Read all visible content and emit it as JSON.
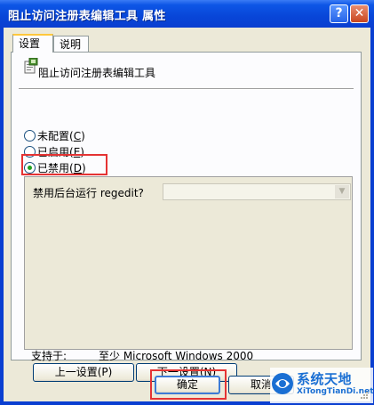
{
  "window": {
    "title": "阻止访问注册表编辑工具 属性",
    "help_glyph": "?",
    "close_glyph": "✕"
  },
  "tabs": [
    {
      "label": "设置",
      "active": true
    },
    {
      "label": "说明",
      "active": false
    }
  ],
  "policy": {
    "title": "阻止访问注册表编辑工具",
    "icon": "policy-setting-icon"
  },
  "radios": [
    {
      "label": "未配置",
      "key": "C",
      "checked": false
    },
    {
      "label": "已启用",
      "key": "E",
      "checked": false
    },
    {
      "label": "已禁用",
      "key": "D",
      "checked": true
    }
  ],
  "options": {
    "label": "禁用后台运行 regedit?",
    "select_value": "",
    "arrow_glyph": "▼"
  },
  "support": {
    "label": "支持于:",
    "value": "至少 Microsoft Windows 2000"
  },
  "buttons": {
    "prev": "上一设置(P)",
    "next": "下一设置(N)",
    "ok": "确定",
    "cancel": "取消"
  },
  "watermark": {
    "title": "系统天地",
    "subtitle": "XiTongTianDi.net"
  },
  "colors": {
    "titlebar": "#0846d8",
    "highlight": "#e53333",
    "face": "#ece9d8"
  }
}
